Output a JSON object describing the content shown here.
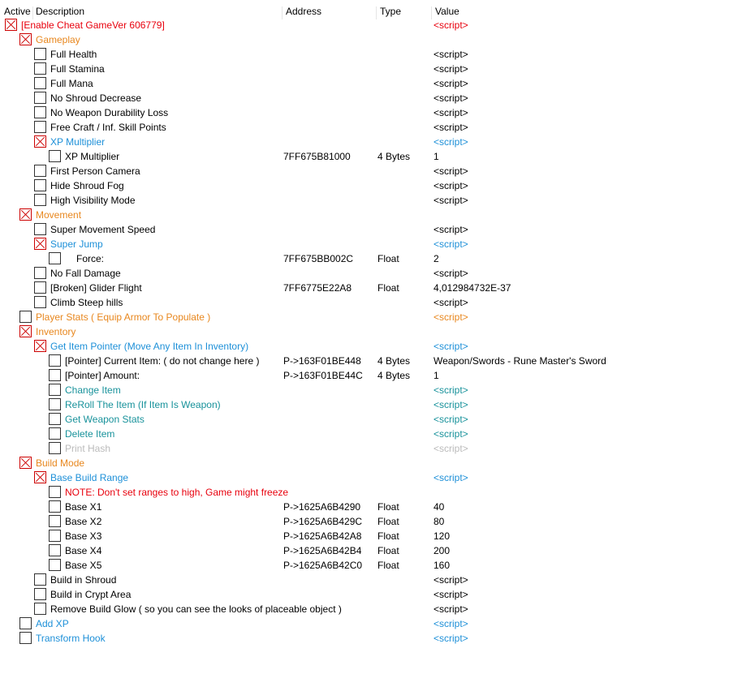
{
  "colors": {
    "red": "#e8000d",
    "orange": "#e8871e",
    "blue": "#1e90d8",
    "teal": "#18929b",
    "gray": "#bbbbbb",
    "black": "#000000"
  },
  "header": {
    "active": "Active",
    "description": "Description",
    "address": "Address",
    "type": "Type",
    "value": "Value"
  },
  "rows": [
    {
      "indent": 0,
      "checked": true,
      "desc": "[Enable Cheat GameVer 606779]",
      "addr": "",
      "type": "",
      "value": "<script>",
      "color": "red"
    },
    {
      "indent": 1,
      "checked": true,
      "desc": "Gameplay",
      "addr": "",
      "type": "",
      "value": "",
      "color": "orange"
    },
    {
      "indent": 2,
      "checked": false,
      "desc": "Full Health",
      "addr": "",
      "type": "",
      "value": "<script>",
      "color": "black"
    },
    {
      "indent": 2,
      "checked": false,
      "desc": "Full Stamina",
      "addr": "",
      "type": "",
      "value": "<script>",
      "color": "black"
    },
    {
      "indent": 2,
      "checked": false,
      "desc": "Full Mana",
      "addr": "",
      "type": "",
      "value": "<script>",
      "color": "black"
    },
    {
      "indent": 2,
      "checked": false,
      "desc": "No Shroud Decrease",
      "addr": "",
      "type": "",
      "value": "<script>",
      "color": "black"
    },
    {
      "indent": 2,
      "checked": false,
      "desc": "No Weapon Durability Loss",
      "addr": "",
      "type": "",
      "value": "<script>",
      "color": "black"
    },
    {
      "indent": 2,
      "checked": false,
      "desc": "Free Craft / Inf. Skill Points",
      "addr": "",
      "type": "",
      "value": "<script>",
      "color": "black"
    },
    {
      "indent": 2,
      "checked": true,
      "desc": "XP Multiplier",
      "addr": "",
      "type": "",
      "value": "<script>",
      "color": "blue"
    },
    {
      "indent": 3,
      "checked": false,
      "desc": "XP Multiplier",
      "addr": "7FF675B81000",
      "type": "4 Bytes",
      "value": "1",
      "color": "black"
    },
    {
      "indent": 2,
      "checked": false,
      "desc": "First Person Camera",
      "addr": "",
      "type": "",
      "value": "<script>",
      "color": "black"
    },
    {
      "indent": 2,
      "checked": false,
      "desc": "Hide Shroud Fog",
      "addr": "",
      "type": "",
      "value": "<script>",
      "color": "black"
    },
    {
      "indent": 2,
      "checked": false,
      "desc": "High Visibility Mode",
      "addr": "",
      "type": "",
      "value": "<script>",
      "color": "black"
    },
    {
      "indent": 1,
      "checked": true,
      "desc": "Movement",
      "addr": "",
      "type": "",
      "value": "",
      "color": "orange"
    },
    {
      "indent": 2,
      "checked": false,
      "desc": "Super Movement Speed",
      "addr": "",
      "type": "",
      "value": "<script>",
      "color": "black"
    },
    {
      "indent": 2,
      "checked": true,
      "desc": "Super Jump",
      "addr": "",
      "type": "",
      "value": "<script>",
      "color": "blue"
    },
    {
      "indent": 3,
      "checked": false,
      "desc": "Force:",
      "addr": "7FF675BB002C",
      "type": "Float",
      "value": "2",
      "color": "black",
      "descShift": 14
    },
    {
      "indent": 2,
      "checked": false,
      "desc": "No Fall Damage",
      "addr": "",
      "type": "",
      "value": "<script>",
      "color": "black"
    },
    {
      "indent": 2,
      "checked": false,
      "desc": "[Broken] Glider Flight",
      "addr": "7FF6775E22A8",
      "type": "Float",
      "value": "4,012984732E-37",
      "color": "black"
    },
    {
      "indent": 2,
      "checked": false,
      "desc": "Climb Steep hills",
      "addr": "",
      "type": "",
      "value": "<script>",
      "color": "black"
    },
    {
      "indent": 1,
      "checked": false,
      "desc": "Player Stats ( Equip Armor To Populate )",
      "addr": "",
      "type": "",
      "value": "<script>",
      "color": "orange"
    },
    {
      "indent": 1,
      "checked": true,
      "desc": "Inventory",
      "addr": "",
      "type": "",
      "value": "",
      "color": "orange"
    },
    {
      "indent": 2,
      "checked": true,
      "desc": "Get Item Pointer (Move Any Item In Inventory)",
      "addr": "",
      "type": "",
      "value": "<script>",
      "color": "blue"
    },
    {
      "indent": 3,
      "checked": false,
      "desc": "[Pointer] Current Item: ( do not change here )",
      "addr": "P->163F01BE448",
      "type": "4 Bytes",
      "value": "Weapon/Swords - Rune Master's Sword",
      "color": "black"
    },
    {
      "indent": 3,
      "checked": false,
      "desc": "[Pointer] Amount:",
      "addr": "P->163F01BE44C",
      "type": "4 Bytes",
      "value": "1",
      "color": "black"
    },
    {
      "indent": 3,
      "checked": false,
      "desc": "Change Item",
      "addr": "",
      "type": "",
      "value": "<script>",
      "color": "teal"
    },
    {
      "indent": 3,
      "checked": false,
      "desc": "ReRoll The Item (If Item Is Weapon)",
      "addr": "",
      "type": "",
      "value": "<script>",
      "color": "teal"
    },
    {
      "indent": 3,
      "checked": false,
      "desc": "Get Weapon Stats",
      "addr": "",
      "type": "",
      "value": "<script>",
      "color": "teal"
    },
    {
      "indent": 3,
      "checked": false,
      "desc": "Delete Item",
      "addr": "",
      "type": "",
      "value": "<script>",
      "color": "teal"
    },
    {
      "indent": 3,
      "checked": false,
      "desc": "Print Hash",
      "addr": "",
      "type": "",
      "value": "<script>",
      "color": "gray"
    },
    {
      "indent": 1,
      "checked": true,
      "desc": "Build Mode",
      "addr": "",
      "type": "",
      "value": "",
      "color": "orange"
    },
    {
      "indent": 2,
      "checked": true,
      "desc": "Base Build Range",
      "addr": "",
      "type": "",
      "value": "<script>",
      "color": "blue"
    },
    {
      "indent": 3,
      "checked": false,
      "desc": "NOTE: Don't set ranges to high, Game might freeze",
      "addr": "",
      "type": "",
      "value": "",
      "color": "red"
    },
    {
      "indent": 3,
      "checked": false,
      "desc": "Base X1",
      "addr": "P->1625A6B4290",
      "type": "Float",
      "value": "40",
      "color": "black"
    },
    {
      "indent": 3,
      "checked": false,
      "desc": "Base X2",
      "addr": "P->1625A6B429C",
      "type": "Float",
      "value": "80",
      "color": "black"
    },
    {
      "indent": 3,
      "checked": false,
      "desc": "Base X3",
      "addr": "P->1625A6B42A8",
      "type": "Float",
      "value": "120",
      "color": "black"
    },
    {
      "indent": 3,
      "checked": false,
      "desc": "Base X4",
      "addr": "P->1625A6B42B4",
      "type": "Float",
      "value": "200",
      "color": "black"
    },
    {
      "indent": 3,
      "checked": false,
      "desc": "Base X5",
      "addr": "P->1625A6B42C0",
      "type": "Float",
      "value": "160",
      "color": "black"
    },
    {
      "indent": 2,
      "checked": false,
      "desc": "Build in Shroud",
      "addr": "",
      "type": "",
      "value": "<script>",
      "color": "black"
    },
    {
      "indent": 2,
      "checked": false,
      "desc": "Build in Crypt Area",
      "addr": "",
      "type": "",
      "value": "<script>",
      "color": "black"
    },
    {
      "indent": 2,
      "checked": false,
      "desc": "Remove Build Glow ( so you can see the looks of placeable object )",
      "addr": "",
      "type": "",
      "value": "<script>",
      "color": "black"
    },
    {
      "indent": 1,
      "checked": false,
      "desc": "Add XP",
      "addr": "",
      "type": "",
      "value": "<script>",
      "color": "blue"
    },
    {
      "indent": 1,
      "checked": false,
      "desc": "Transform Hook",
      "addr": "",
      "type": "",
      "value": "<script>",
      "color": "blue"
    }
  ]
}
